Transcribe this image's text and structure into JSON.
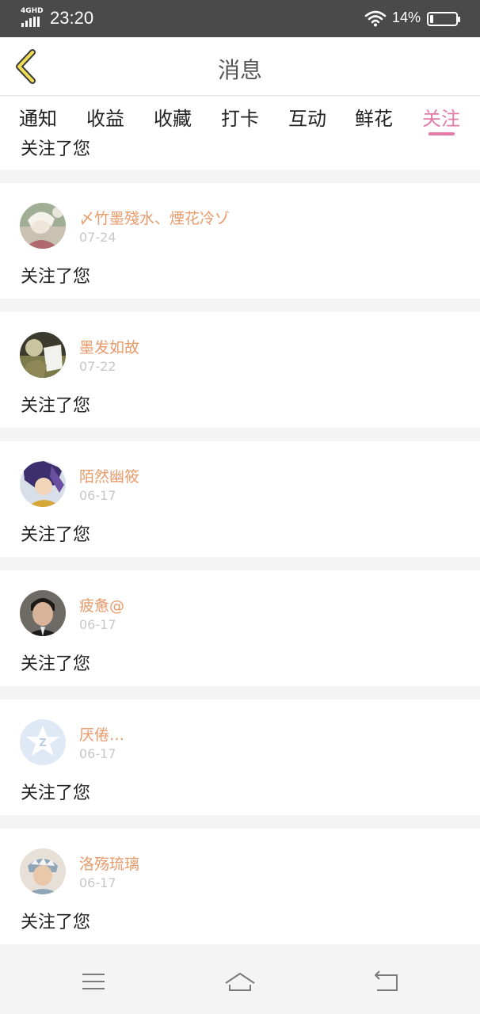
{
  "status_bar": {
    "network": "4GHD",
    "time": "23:20",
    "battery_percent": "14%",
    "battery_level": 0.14
  },
  "header": {
    "title": "消息",
    "back_icon": "chevron-left-icon"
  },
  "tabs": [
    {
      "label": "通知",
      "active": false
    },
    {
      "label": "收益",
      "active": false
    },
    {
      "label": "收藏",
      "active": false
    },
    {
      "label": "打卡",
      "active": false
    },
    {
      "label": "互动",
      "active": false
    },
    {
      "label": "鲜花",
      "active": false
    },
    {
      "label": "关注",
      "active": true
    }
  ],
  "colors": {
    "accent": "#e57aa8",
    "username": "#e89a6a",
    "date": "#c7c7c7",
    "status_bar": "#4a4a4a"
  },
  "partial_item": {
    "action": "关注了您"
  },
  "notifications": [
    {
      "name": "〆竹墨殘水、煙花冷ゾ",
      "date": "07-24",
      "action": "关注了您"
    },
    {
      "name": "墨发如故",
      "date": "07-22",
      "action": "关注了您"
    },
    {
      "name": "陌然幽筱",
      "date": "06-17",
      "action": "关注了您"
    },
    {
      "name": "疲惫@",
      "date": "06-17",
      "action": "关注了您"
    },
    {
      "name": "厌倦…",
      "date": "06-17",
      "action": "关注了您"
    },
    {
      "name": "洛殇琉璃",
      "date": "06-17",
      "action": "关注了您"
    }
  ],
  "navbar": {
    "items": [
      "menu-icon",
      "home-icon",
      "back-icon"
    ]
  }
}
